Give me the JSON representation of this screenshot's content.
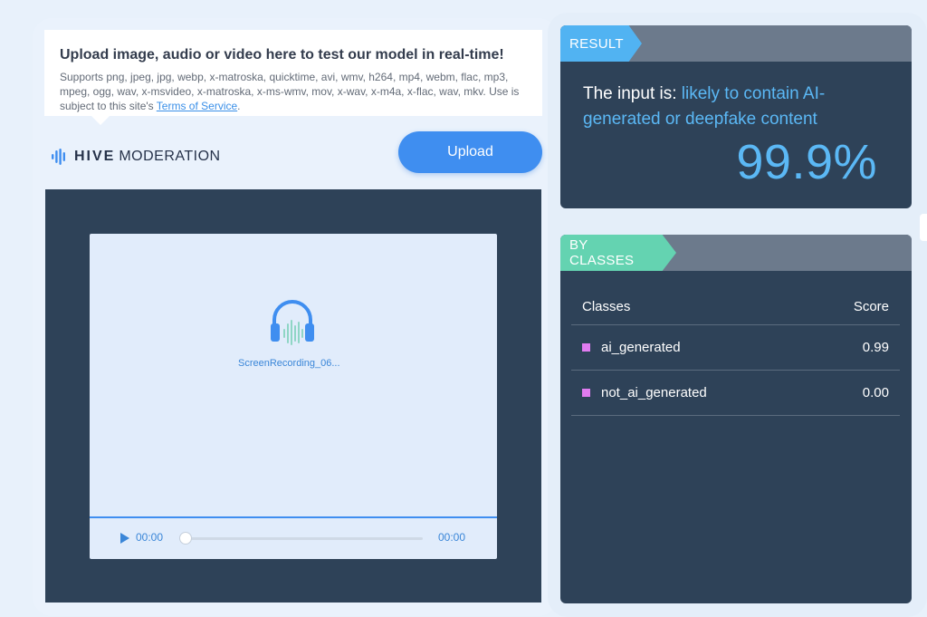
{
  "upload": {
    "title": "Upload image, audio or video here to test our model in real-time!",
    "supports_text": "Supports png, jpeg, jpg, webp, x-matroska, quicktime, avi, wmv, h264, mp4, webm, flac, mp3, mpeg, ogg, wav, x-msvideo, x-matroska, x-ms-wmv, mov, x-wav, x-m4a, x-flac, wav, mkv. Use is subject to this site's ",
    "terms_link": "Terms of Service",
    "terms_suffix": ".",
    "button_label": "Upload"
  },
  "brand": {
    "name_bold": "HIVE",
    "name_rest": "MODERATION",
    "logo_icon": "hive-bars-icon",
    "color": "#3f8ef0"
  },
  "media": {
    "icon": "headphones-icon",
    "filename": "ScreenRecording_06...",
    "current_time": "00:00",
    "duration": "00:00",
    "progress": 0
  },
  "result": {
    "tag": "RESULT",
    "prefix": "The input is: ",
    "verdict": "likely to contain AI-generated or deepfake content",
    "score": "99.9%"
  },
  "classes": {
    "tag": "BY CLASSES",
    "header_class": "Classes",
    "header_score": "Score",
    "rows": [
      {
        "name": "ai_generated",
        "score": "0.99"
      },
      {
        "name": "not_ai_generated",
        "score": "0.00"
      }
    ]
  },
  "colors": {
    "accent": "#3f8ef0",
    "dark_panel": "#2e4258",
    "result_tag": "#51b3f2",
    "classes_tag": "#64d3b1",
    "class_marker": "#e07cf0"
  }
}
